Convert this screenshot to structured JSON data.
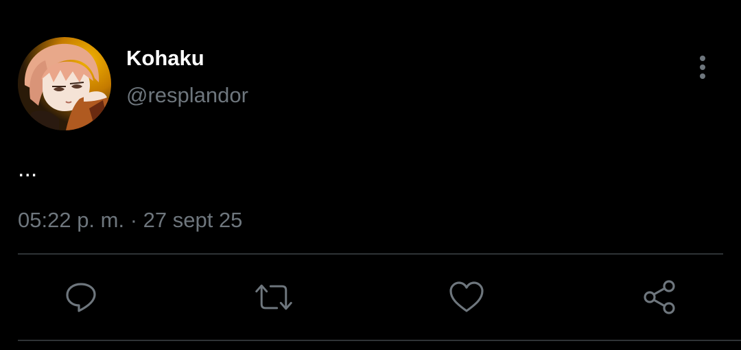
{
  "tweet": {
    "author": {
      "display_name": "Kohaku",
      "handle": "@resplandor",
      "avatar_icon": "anime-avatar"
    },
    "text": "...",
    "timestamp": "05:22 p. m. · 27 sept 25",
    "menu_icon": "more-vertical-icon"
  },
  "actions": [
    {
      "name": "reply",
      "icon": "reply-icon"
    },
    {
      "name": "retweet",
      "icon": "retweet-icon"
    },
    {
      "name": "like",
      "icon": "heart-icon"
    },
    {
      "name": "share",
      "icon": "share-icon"
    }
  ],
  "colors": {
    "background": "#000000",
    "primary_text": "#ffffff",
    "secondary_text": "#6e767d",
    "divider": "#2f3336",
    "icon": "#6e767d"
  }
}
